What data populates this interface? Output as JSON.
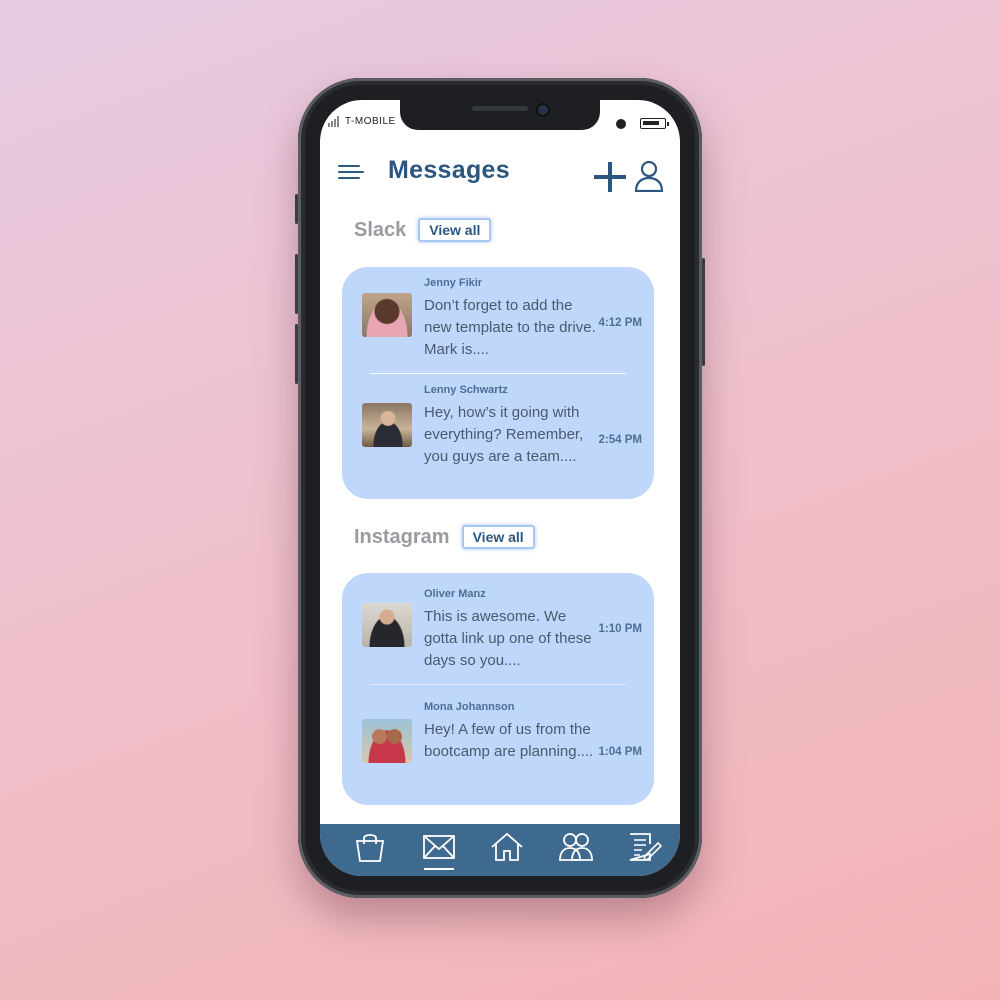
{
  "status_bar": {
    "carrier": "T-MOBILE"
  },
  "header": {
    "title": "Messages"
  },
  "sections": [
    {
      "label": "Slack",
      "view_all": "View all",
      "messages": [
        {
          "sender": "Jenny Fikir",
          "preview": "Don’t forget to add the new template to the drive. Mark is....",
          "time": "4:12 PM"
        },
        {
          "sender": "Lenny Schwartz",
          "preview": "Hey, how’s it going with everything? Remember, you guys are a  team....",
          "time": "2:54 PM"
        }
      ]
    },
    {
      "label": "Instagram",
      "view_all": "View all",
      "messages": [
        {
          "sender": "Oliver Manz",
          "preview": "This is awesome. We gotta link up one of these days so you....",
          "time": "1:10 PM"
        },
        {
          "sender": "Mona Johannson",
          "preview": "Hey!  A few of us from the bootcamp are planning....",
          "time": "1:04 PM"
        }
      ]
    }
  ],
  "tabbar": {
    "items": [
      "shopping-bag-icon",
      "mail-icon",
      "home-icon",
      "people-icon",
      "notes-icon"
    ],
    "active": "mail-icon"
  },
  "colors": {
    "accent": "#2b567f",
    "card": "#bed7fa",
    "tabbar": "#3f6a90"
  }
}
